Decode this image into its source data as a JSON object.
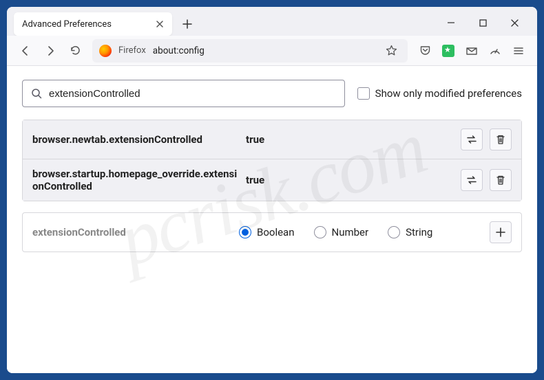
{
  "window": {
    "tab_title": "Advanced Preferences"
  },
  "toolbar": {
    "identity": "Firefox",
    "url": "about:config"
  },
  "search": {
    "value": "extensionControlled",
    "show_only_modified_label": "Show only modified preferences"
  },
  "prefs": [
    {
      "name": "browser.newtab.extensionControlled",
      "value": "true"
    },
    {
      "name": "browser.startup.homepage_override.extensionControlled",
      "value": "true"
    }
  ],
  "add": {
    "name": "extensionControlled",
    "types": [
      "Boolean",
      "Number",
      "String"
    ],
    "selected": "Boolean"
  },
  "watermark": "pcrisk.com"
}
